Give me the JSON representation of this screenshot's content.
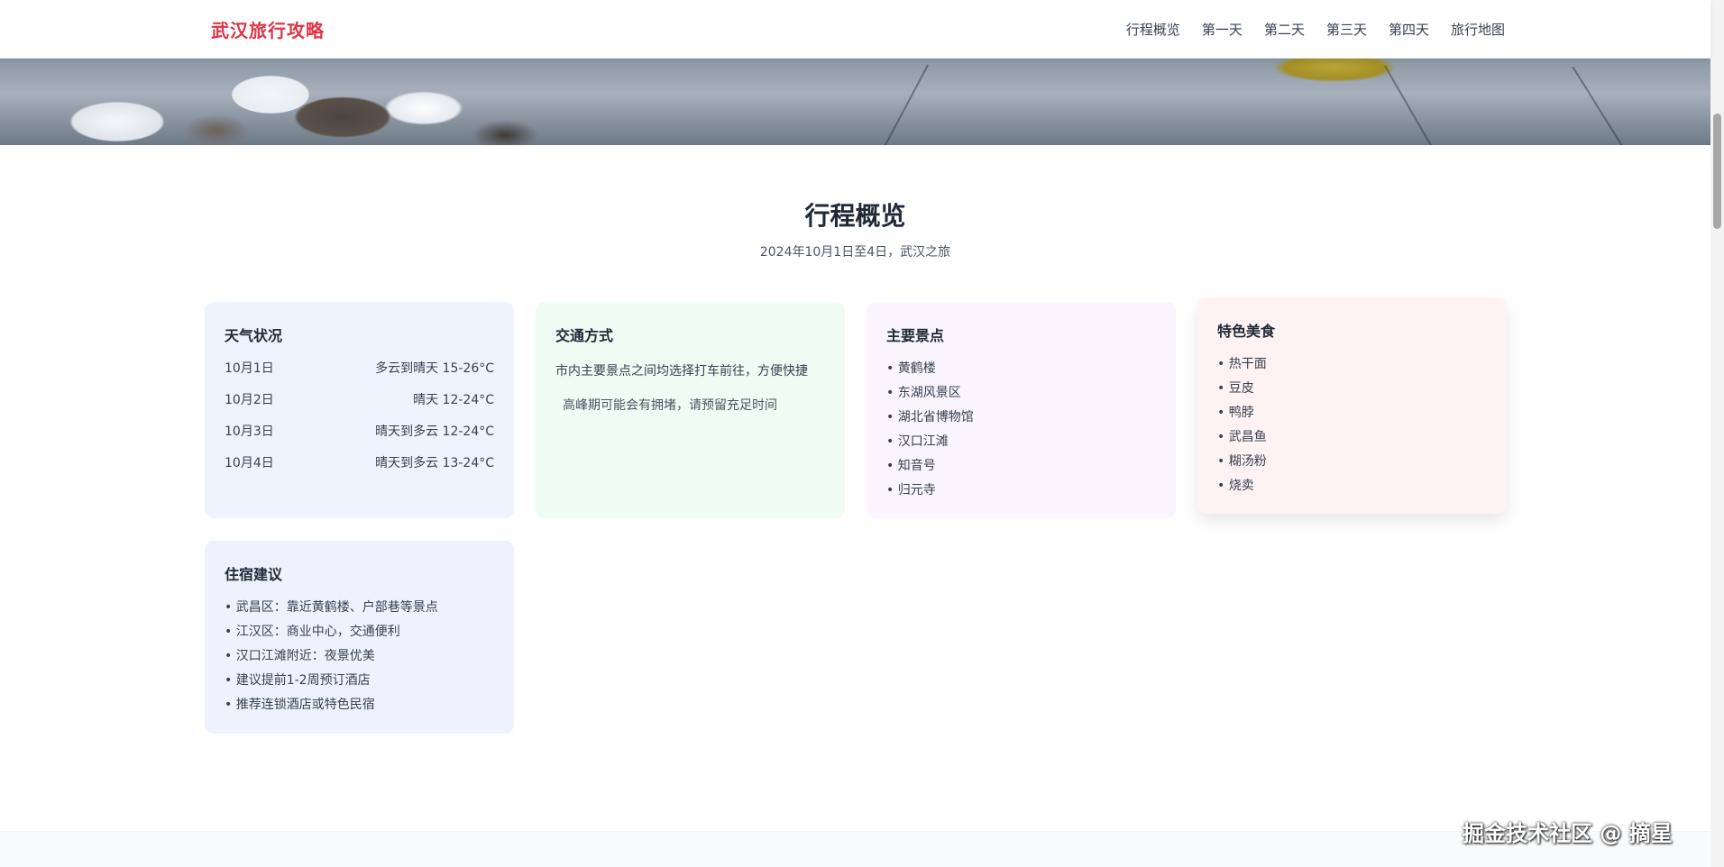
{
  "header": {
    "brand": "武汉旅行攻略",
    "nav": [
      "行程概览",
      "第一天",
      "第二天",
      "第三天",
      "第四天",
      "旅行地图"
    ]
  },
  "overview": {
    "title": "行程概览",
    "subtitle": "2024年10月1日至4日，武汉之旅"
  },
  "weather": {
    "title": "天气状况",
    "rows": [
      {
        "date": "10月1日",
        "forecast": "多云到晴天 15-26°C"
      },
      {
        "date": "10月2日",
        "forecast": "晴天 12-24°C"
      },
      {
        "date": "10月3日",
        "forecast": "晴天到多云 12-24°C"
      },
      {
        "date": "10月4日",
        "forecast": "晴天到多云 13-24°C"
      }
    ]
  },
  "transport": {
    "title": "交通方式",
    "text": "市内主要景点之间均选择打车前往，方便快捷",
    "note": "高峰期可能会有拥堵，请预留充足时间"
  },
  "sights": {
    "title": "主要景点",
    "items": [
      "黄鹤楼",
      "东湖风景区",
      "湖北省博物馆",
      "汉口江滩",
      "知音号",
      "归元寺"
    ]
  },
  "food": {
    "title": "特色美食",
    "items": [
      "热干面",
      "豆皮",
      "鸭脖",
      "武昌鱼",
      "糊汤粉",
      "烧卖"
    ]
  },
  "lodging": {
    "title": "住宿建议",
    "items": [
      "武昌区：靠近黄鹤楼、户部巷等景点",
      "江汉区：商业中心，交通便利",
      "汉口江滩附近：夜景优美",
      "建议提前1-2周预订酒店",
      "推荐连锁酒店或特色民宿"
    ]
  },
  "watermark": "掘金技术社区 @ 摘星",
  "colors": {
    "brand": "#dc3545",
    "weather_bg": "#eef4fe",
    "transport_bg": "#effcf3",
    "sights_bg": "#f9f4fe",
    "food_bg": "#fef2f2",
    "lodging_bg": "#edf2fe"
  }
}
